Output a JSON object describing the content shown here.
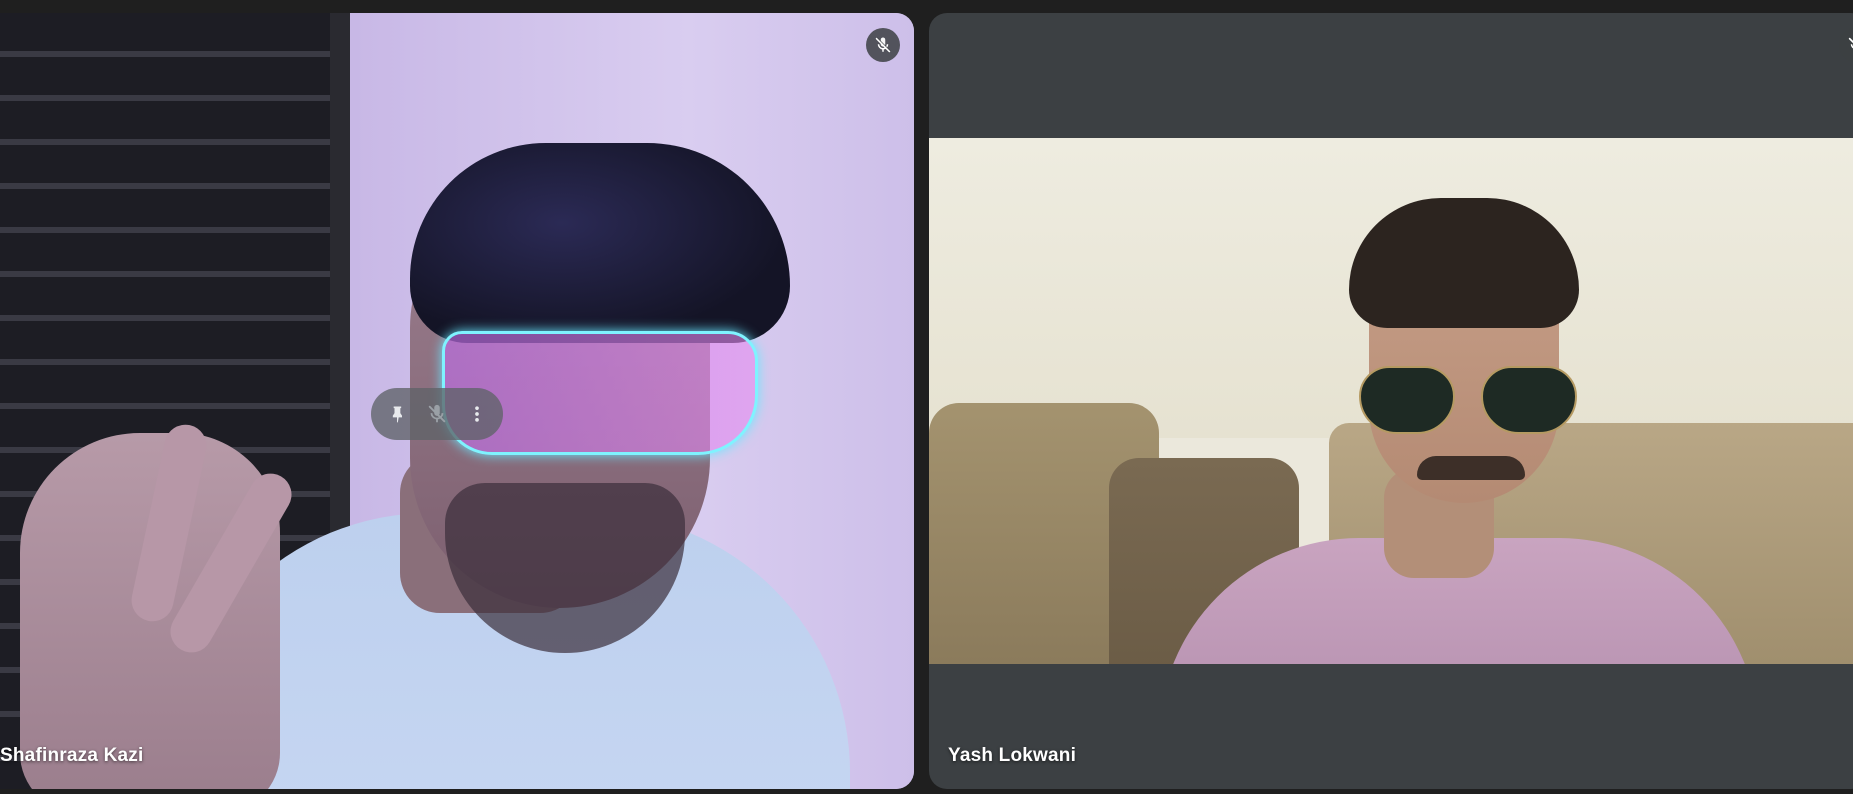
{
  "participants": [
    {
      "name": "Shafinraza Kazi",
      "mic_status": "muted",
      "mic_icon": "mic-off-icon"
    },
    {
      "name": "Yash Lokwani",
      "mic_status": "muted",
      "mic_icon": "mic-off-icon"
    }
  ],
  "tile_controls": {
    "pin_icon": "pin-icon",
    "mute_icon": "mic-off-icon",
    "more_icon": "more-vert-icon"
  },
  "colors": {
    "background": "#1f1f1f",
    "tile_background": "#3c4043",
    "label_text": "#ffffff"
  }
}
